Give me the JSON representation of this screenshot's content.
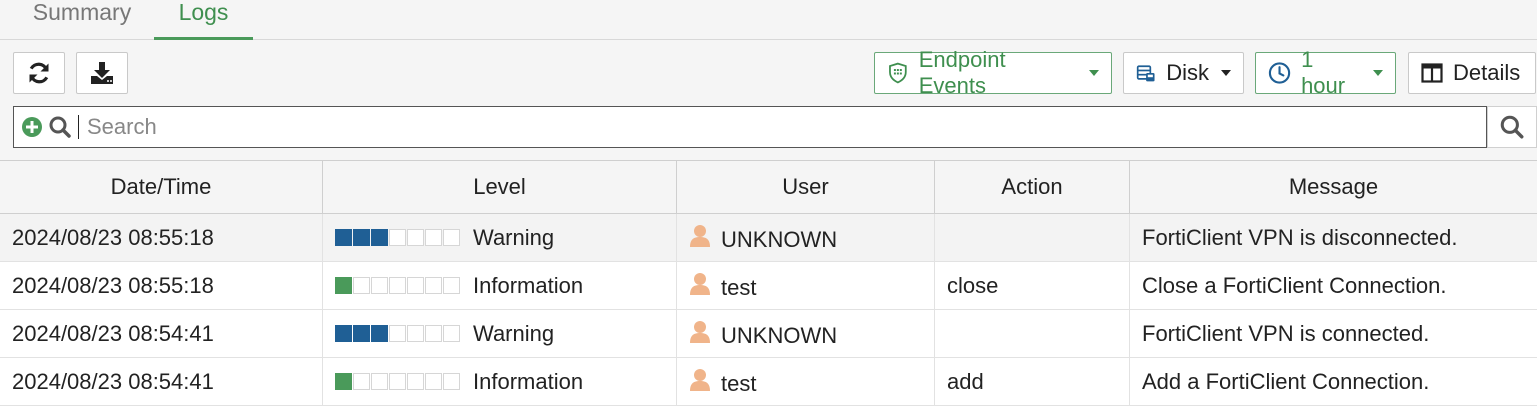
{
  "tabs": [
    {
      "label": "Summary",
      "active": false
    },
    {
      "label": "Logs",
      "active": true
    }
  ],
  "toolbar": {
    "refresh_icon": "refresh-icon",
    "download_icon": "download-icon",
    "log_type": "Endpoint Events",
    "source": "Disk",
    "time_range": "1 hour",
    "details_label": "Details"
  },
  "search": {
    "placeholder": "Search",
    "value": ""
  },
  "table": {
    "columns": [
      "Date/Time",
      "Level",
      "User",
      "Action",
      "Message"
    ],
    "rows": [
      {
        "datetime": "2024/08/23 08:55:18",
        "level": "Warning",
        "user": "UNKNOWN",
        "action": "",
        "message": "FortiClient VPN is disconnected."
      },
      {
        "datetime": "2024/08/23 08:55:18",
        "level": "Information",
        "user": "test",
        "action": "close",
        "message": "Close a FortiClient Connection."
      },
      {
        "datetime": "2024/08/23 08:54:41",
        "level": "Warning",
        "user": "UNKNOWN",
        "action": "",
        "message": "FortiClient VPN is connected."
      },
      {
        "datetime": "2024/08/23 08:54:41",
        "level": "Information",
        "user": "test",
        "action": "add",
        "message": "Add a FortiClient Connection."
      }
    ]
  },
  "colors": {
    "accent_green": "#4a9a5a",
    "warning_blue": "#1f5f95",
    "user_icon": "#f0b48a"
  }
}
